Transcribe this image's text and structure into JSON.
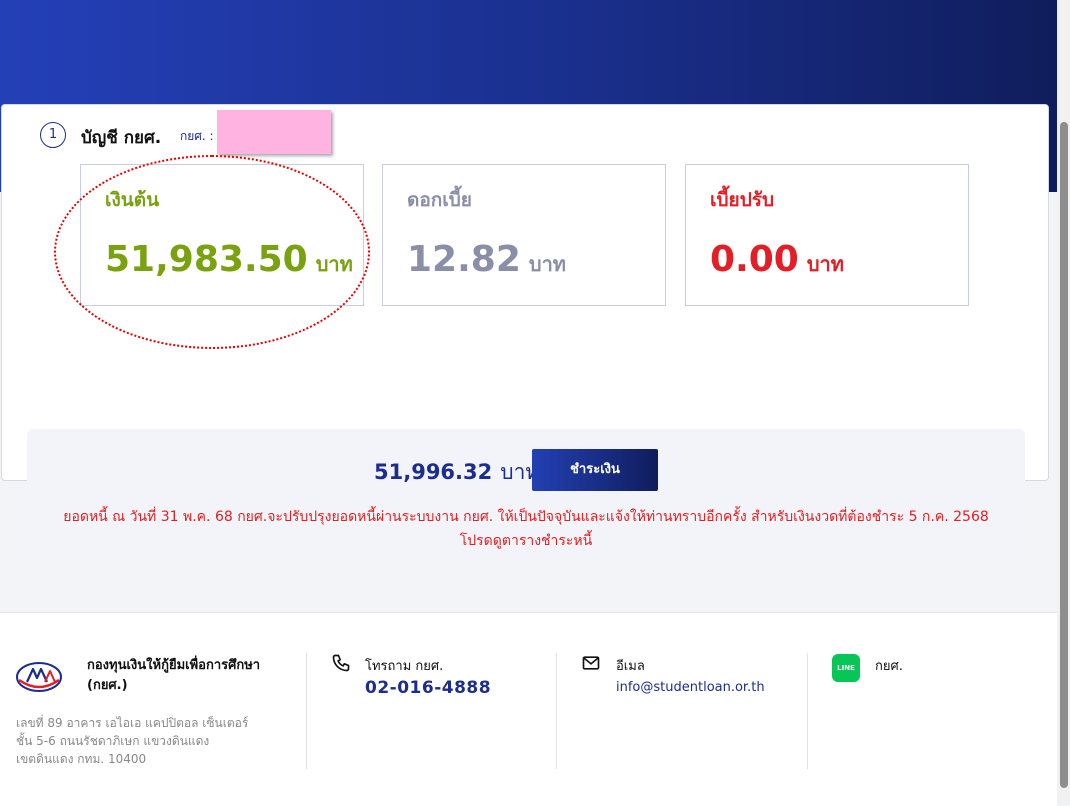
{
  "account": {
    "step_number": "1",
    "title": "บัญชี กยศ.",
    "id_label": "กยศ. :"
  },
  "stats": {
    "principal": {
      "label": "เงินต้น",
      "value": "51,983.50",
      "unit": "บาท",
      "color": "#7aa10f"
    },
    "interest": {
      "label": "ดอกเบี้ย",
      "value": "12.82",
      "unit": "บาท",
      "color": "#8a8fa8"
    },
    "penalty": {
      "label": "เบี้ยปรับ",
      "value": "0.00",
      "unit": "บาท",
      "color": "#e21f26"
    }
  },
  "summary": {
    "total": "51,996.32",
    "unit": "บาท",
    "pay_button": "ชำระเงิน",
    "notice": "ยอดหนี้ ณ วันที่ 31 พ.ค. 68 กยศ.จะปรับปรุงยอดหนี้ผ่านระบบงาน กยศ. ให้เป็นปัจจุบันและแจ้งให้ท่านทราบอีกครั้ง สำหรับเงินงวดที่ต้องชำระ 5 ก.ค. 2568 โปรดดูตารางชำระหนี้"
  },
  "footer": {
    "org_name": "กองทุนเงินให้กู้ยืมเพื่อการศึกษา (กยศ.)",
    "address_line1": "เลขที่ 89 อาคาร เอไอเอ แคปปิตอล เซ็นเตอร์",
    "address_line2": "ชั้น 5-6 ถนนรัชดาภิเษก แขวงดินแดง",
    "address_line3": "เขตดินแดง กทม. 10400",
    "phone_label": "โทรถาม กยศ.",
    "phone": "02-016-4888",
    "email_label": "อีเมล",
    "email": "info@studentloan.or.th",
    "line_badge": "LINE",
    "line_label": "กยศ."
  },
  "icons": {
    "phone": "phone-icon",
    "mail": "mail-icon",
    "line": "line-icon",
    "logo": "logo-icon"
  },
  "colors": {
    "brand_blue": "#1b2d8f",
    "warning_red": "#e02020",
    "line_green": "#06c755"
  }
}
